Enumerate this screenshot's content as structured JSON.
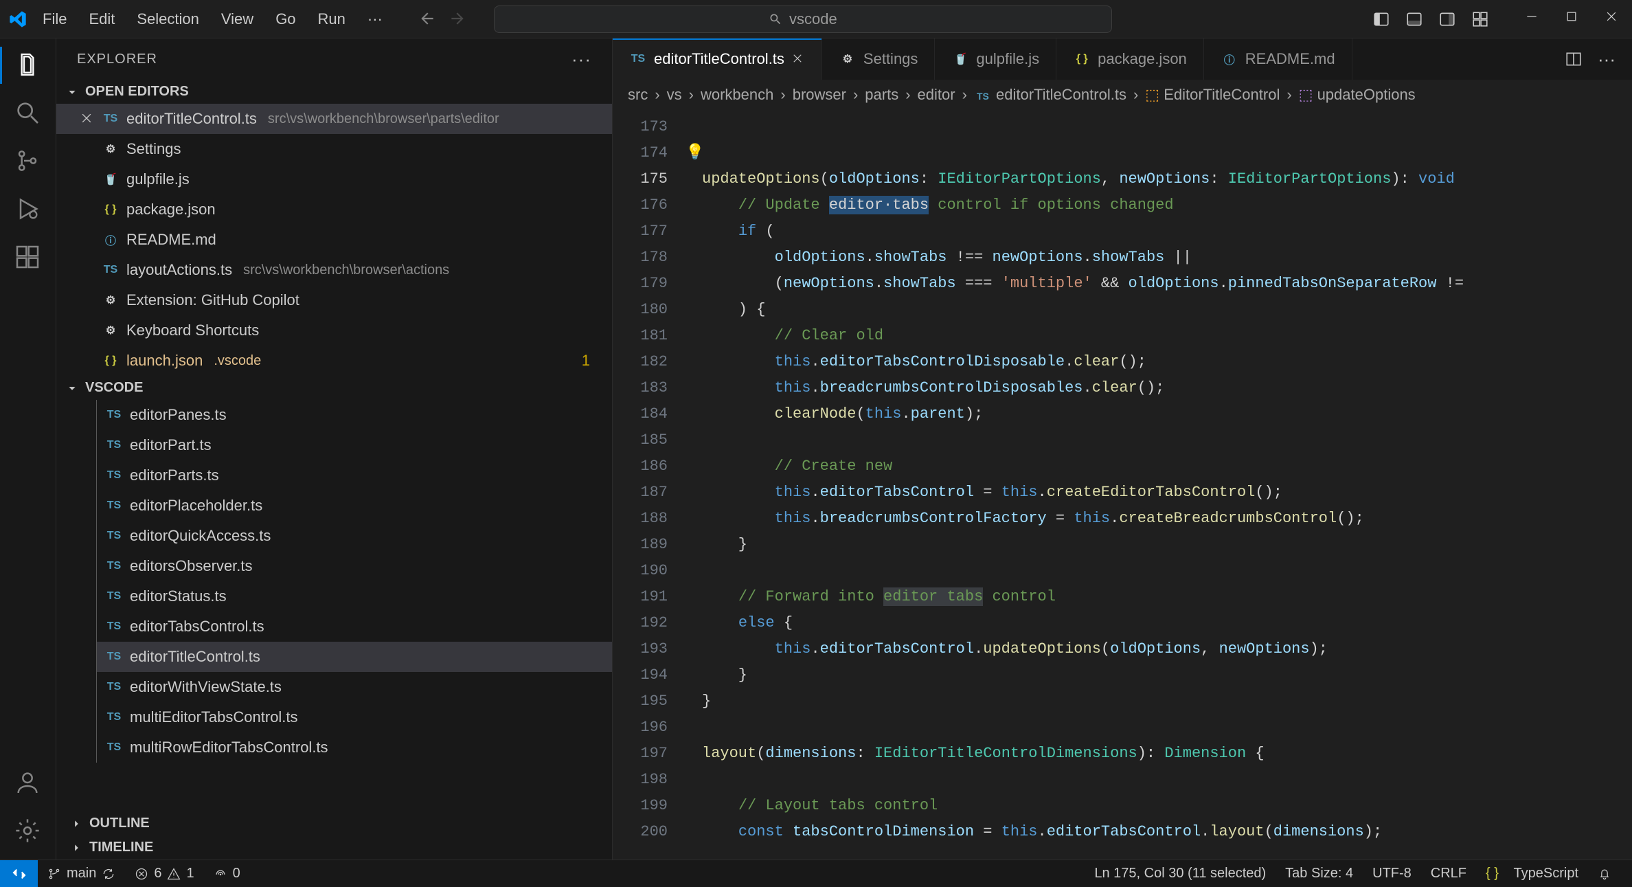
{
  "menu": {
    "file": "File",
    "edit": "Edit",
    "selection": "Selection",
    "view": "View",
    "go": "Go",
    "run": "Run"
  },
  "search": {
    "placeholder": "vscode"
  },
  "sidebar": {
    "title": "EXPLORER",
    "sections": {
      "openEditors": "OPEN EDITORS",
      "workspace": "VSCODE",
      "outline": "OUTLINE",
      "timeline": "TIMELINE"
    },
    "openEditors": [
      {
        "icon": "ts",
        "name": "editorTitleControl.ts",
        "path": "src\\vs\\workbench\\browser\\parts\\editor",
        "active": true
      },
      {
        "icon": "gear",
        "name": "Settings"
      },
      {
        "icon": "gulp",
        "name": "gulpfile.js"
      },
      {
        "icon": "json",
        "name": "package.json"
      },
      {
        "icon": "info",
        "name": "README.md"
      },
      {
        "icon": "ts",
        "name": "layoutActions.ts",
        "path": "src\\vs\\workbench\\browser\\actions"
      },
      {
        "icon": "gear",
        "name": "Extension: GitHub Copilot"
      },
      {
        "icon": "gear",
        "name": "Keyboard Shortcuts"
      },
      {
        "icon": "json",
        "name": "launch.json",
        "path": ".vscode",
        "modified": true,
        "badge": "1"
      }
    ],
    "tree": [
      {
        "name": "editorPanes.ts"
      },
      {
        "name": "editorPart.ts"
      },
      {
        "name": "editorParts.ts"
      },
      {
        "name": "editorPlaceholder.ts"
      },
      {
        "name": "editorQuickAccess.ts"
      },
      {
        "name": "editorsObserver.ts"
      },
      {
        "name": "editorStatus.ts"
      },
      {
        "name": "editorTabsControl.ts"
      },
      {
        "name": "editorTitleControl.ts",
        "selected": true
      },
      {
        "name": "editorWithViewState.ts"
      },
      {
        "name": "multiEditorTabsControl.ts"
      },
      {
        "name": "multiRowEditorTabsControl.ts"
      }
    ]
  },
  "tabs": [
    {
      "icon": "ts",
      "label": "editorTitleControl.ts",
      "active": true,
      "close": true
    },
    {
      "icon": "gear",
      "label": "Settings"
    },
    {
      "icon": "gulp",
      "label": "gulpfile.js"
    },
    {
      "icon": "json",
      "label": "package.json"
    },
    {
      "icon": "info",
      "label": "README.md"
    }
  ],
  "breadcrumbs": [
    "src",
    "vs",
    "workbench",
    "browser",
    "parts",
    "editor",
    "editorTitleControl.ts",
    "EditorTitleControl",
    "updateOptions"
  ],
  "gutter": {
    "start": 173,
    "end": 200,
    "current": 175
  },
  "statusbar": {
    "branch": "main",
    "errors": "6",
    "warnings": "1",
    "ports": "0",
    "cursor": "Ln 175, Col 30 (11 selected)",
    "tabsize": "Tab Size: 4",
    "encoding": "UTF-8",
    "eol": "CRLF",
    "language": "TypeScript"
  }
}
